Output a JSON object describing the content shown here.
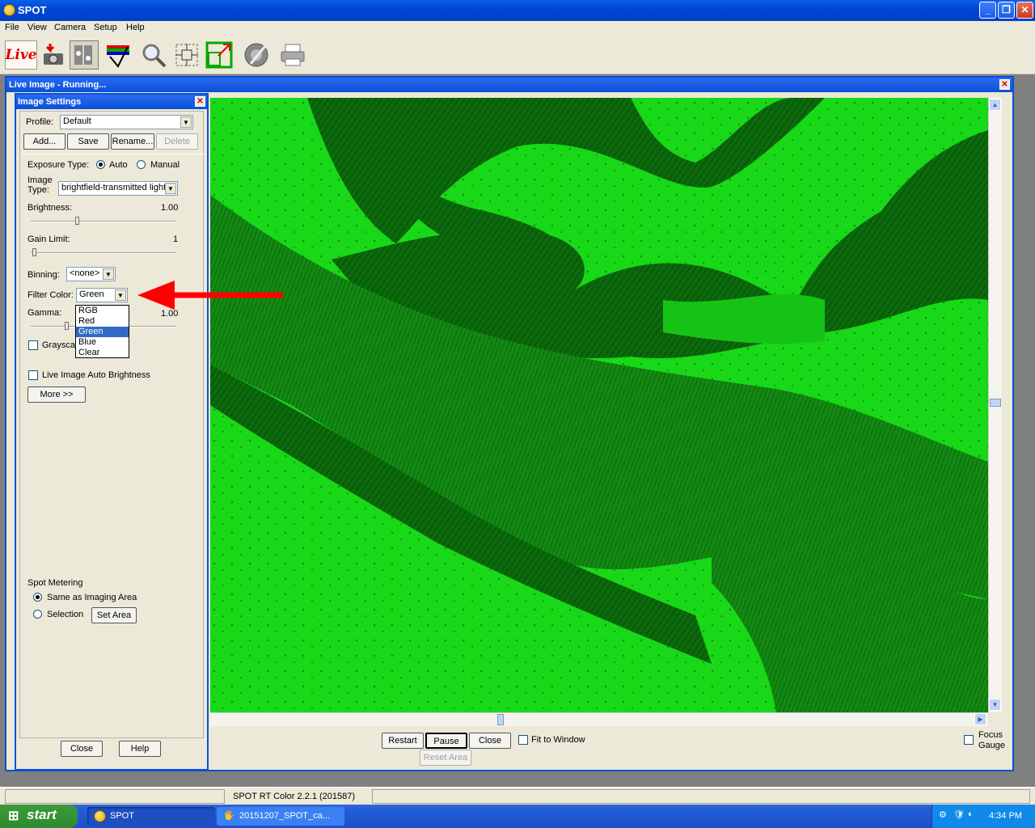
{
  "app": {
    "title": "SPOT"
  },
  "menu": [
    "File",
    "View",
    "Camera",
    "Setup",
    "Help"
  ],
  "toolbar_icons": [
    "live-icon",
    "capture-camera-icon",
    "image-settings-icon",
    "color-filter-icon",
    "zoom-icon",
    "move-icon",
    "resize-icon",
    "focus-gauge-icon",
    "print-icon"
  ],
  "live_label": "Live",
  "live_window": {
    "title": "Live Image - Running...",
    "buttons": {
      "restart": "Restart",
      "pause": "Pause",
      "close": "Close",
      "reset_area": "Reset Area"
    },
    "fit_to_window": "Fit to Window",
    "focus_gauge_1": "Focus",
    "focus_gauge_2": "Gauge"
  },
  "settings": {
    "title": "Image Settings",
    "profile_label": "Profile:",
    "profile_value": "Default",
    "add": "Add...",
    "save": "Save",
    "rename": "Rename...",
    "delete": "Delete",
    "exposure_label": "Exposure Type:",
    "exposure_auto": "Auto",
    "exposure_manual": "Manual",
    "image_type_label_1": "Image",
    "image_type_label_2": "Type:",
    "image_type_value": "brightfield-transmitted light",
    "brightness_label": "Brightness:",
    "brightness_value": "1.00",
    "brightness_level": 0.3,
    "gain_label": "Gain Limit:",
    "gain_value": "1",
    "gain_level": 0.0,
    "binning_label": "Binning:",
    "binning_value": "<none>",
    "filter_label": "Filter Color:",
    "filter_value": "Green",
    "filter_options": [
      "RGB",
      "Red",
      "Green",
      "Blue",
      "Clear"
    ],
    "gamma_label": "Gamma:",
    "gamma_value": "1.00",
    "grayscale_label": "Grayscale",
    "auto_brightness_label": "Live Image Auto Brightness",
    "more": "More >>",
    "spot_metering_label": "Spot Metering",
    "same_as_imaging": "Same as Imaging Area",
    "selection": "Selection",
    "set_area": "Set Area",
    "close": "Close",
    "help": "Help"
  },
  "status": {
    "text": "SPOT RT Color 2.2.1  (201587)"
  },
  "taskbar": {
    "start": "start",
    "tasks": [
      "SPOT",
      "20151207_SPOT_ca..."
    ],
    "clock": "4:34 PM"
  },
  "colors": {
    "accent": "#0a4fd8",
    "image_green": "#18d818",
    "arrow": "#ff0000"
  }
}
